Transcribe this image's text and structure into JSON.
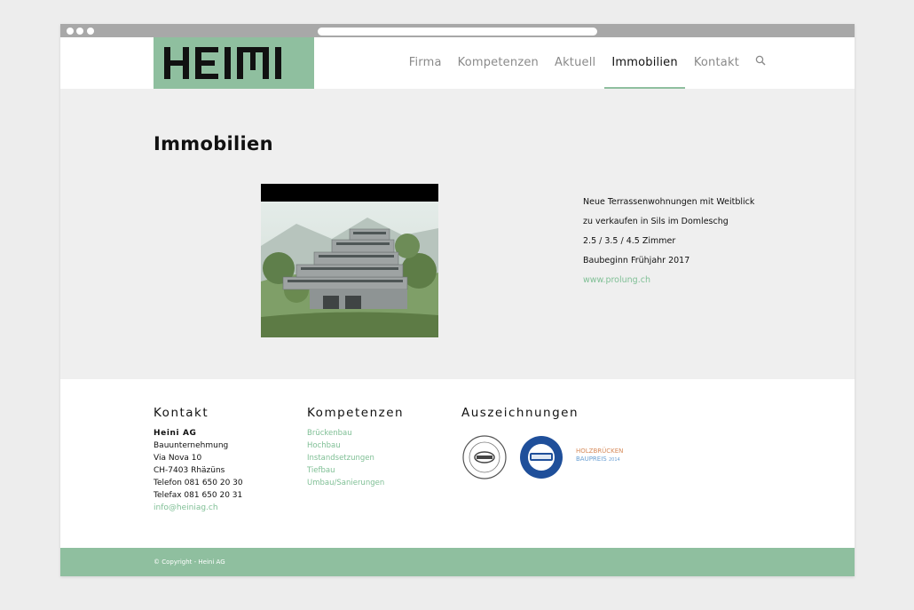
{
  "brand": {
    "logo_text": "HEIMI",
    "accent_color": "#8fbf9f",
    "link_color": "#7fbf95"
  },
  "nav": {
    "items": [
      {
        "label": "Firma"
      },
      {
        "label": "Kompetenzen"
      },
      {
        "label": "Aktuell"
      },
      {
        "label": "Immobilien",
        "active": true
      },
      {
        "label": "Kontakt"
      }
    ],
    "search_icon": "search-icon"
  },
  "main": {
    "title": "Immobilien",
    "property": {
      "image_icon": "building-photo",
      "lines": [
        "Neue Terrassenwohnungen mit Weitblick",
        "zu verkaufen in Sils im Domleschg",
        "2.5 / 3.5 / 4.5 Zimmer",
        "Baubeginn Frühjahr 2017"
      ],
      "link": "www.prolung.ch"
    }
  },
  "footer": {
    "kontakt": {
      "title": "Kontakt",
      "company": "Heini AG",
      "lines": [
        "Bauunternehmung",
        "Via Nova 10",
        "CH-7403 Rhäzüns",
        "Telefon 081 650 20 30",
        "Telefax 081 650 20 31"
      ],
      "email": "info@heiniag.ch"
    },
    "kompetenzen": {
      "title": "Kompetenzen",
      "items": [
        "Brückenbau",
        "Hochbau",
        "Instandsetzungen",
        "Tiefbau",
        "Umbau/Sanierungen"
      ]
    },
    "auszeichnungen": {
      "title": "Auszeichnungen",
      "award_line1": "HOLZBRÜCKEN",
      "award_line2": "BAUPREIS",
      "award_year": "2014",
      "logos": [
        "sqs-seal",
        "iqnet-seal"
      ]
    }
  },
  "bottom": {
    "copyright": "© Copyright - Heini AG"
  }
}
